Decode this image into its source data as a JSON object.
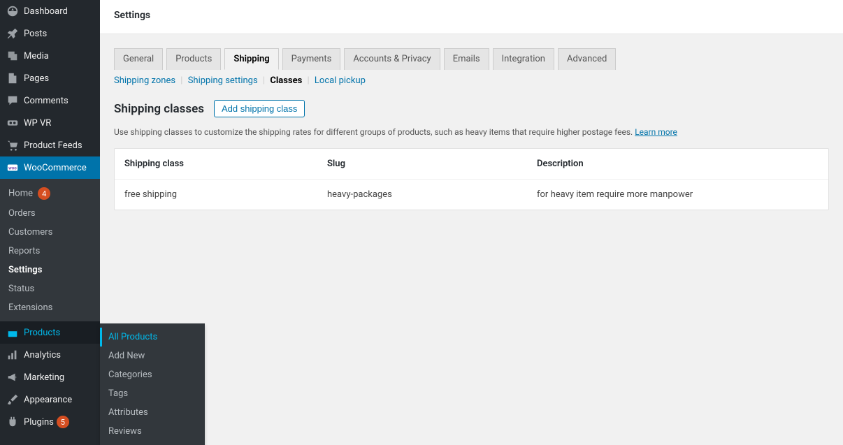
{
  "sidebar": {
    "items": [
      {
        "label": "Dashboard"
      },
      {
        "label": "Posts"
      },
      {
        "label": "Media"
      },
      {
        "label": "Pages"
      },
      {
        "label": "Comments"
      },
      {
        "label": "WP VR"
      },
      {
        "label": "Product Feeds"
      },
      {
        "label": "WooCommerce"
      },
      {
        "label": "Products"
      },
      {
        "label": "Analytics"
      },
      {
        "label": "Marketing"
      },
      {
        "label": "Appearance"
      },
      {
        "label": "Plugins"
      }
    ],
    "woocommerce_submenu": [
      {
        "label": "Home",
        "badge": "4"
      },
      {
        "label": "Orders"
      },
      {
        "label": "Customers"
      },
      {
        "label": "Reports"
      },
      {
        "label": "Settings"
      },
      {
        "label": "Status"
      },
      {
        "label": "Extensions"
      }
    ],
    "products_flyout": [
      {
        "label": "All Products"
      },
      {
        "label": "Add New"
      },
      {
        "label": "Categories"
      },
      {
        "label": "Tags"
      },
      {
        "label": "Attributes"
      },
      {
        "label": "Reviews"
      }
    ],
    "plugins_badge": "5"
  },
  "header": {
    "title": "Settings"
  },
  "tabs": [
    {
      "label": "General"
    },
    {
      "label": "Products"
    },
    {
      "label": "Shipping"
    },
    {
      "label": "Payments"
    },
    {
      "label": "Accounts & Privacy"
    },
    {
      "label": "Emails"
    },
    {
      "label": "Integration"
    },
    {
      "label": "Advanced"
    }
  ],
  "subtabs": {
    "zones": "Shipping zones",
    "settings": "Shipping settings",
    "classes": "Classes",
    "pickup": "Local pickup"
  },
  "section": {
    "title": "Shipping classes",
    "add_button": "Add shipping class",
    "desc": "Use shipping classes to customize the shipping rates for different groups of products, such as heavy items that require higher postage fees. ",
    "learn_more": "Learn more"
  },
  "table": {
    "headers": {
      "class": "Shipping class",
      "slug": "Slug",
      "desc": "Description"
    },
    "rows": [
      {
        "class": "free shipping",
        "slug": "heavy-packages",
        "desc": "for heavy item require more manpower"
      }
    ]
  }
}
